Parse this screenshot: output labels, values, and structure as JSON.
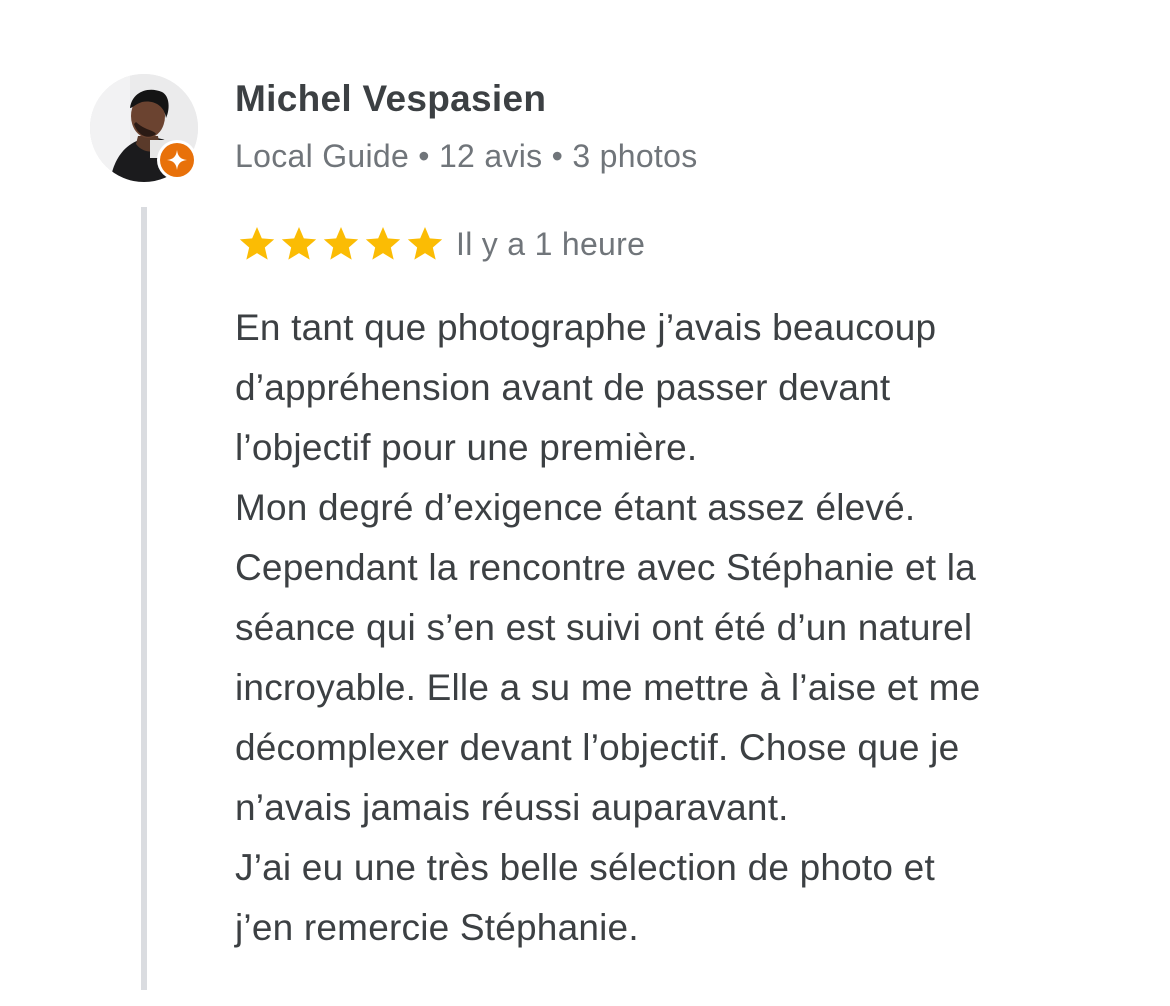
{
  "reviewer": {
    "name": "Michel Vespasien",
    "meta": "Local Guide • 12 avis • 3 photos",
    "avatar_icon": "person-photo-avatar",
    "badge_icon": "local-guide-star-icon",
    "badge_color": "#e8710a"
  },
  "review": {
    "rating": 5,
    "max_rating": 5,
    "star_color": "#fbbc04",
    "time": "Il y a 1 heure",
    "lines": [
      "En tant que photographe j’avais beaucoup",
      "d’appréhension avant de passer devant",
      "l’objectif pour une première.",
      "Mon degré d’exigence étant assez élevé.",
      "Cependant la rencontre avec Stéphanie et la",
      "séance qui s’en est suivi ont été d’un naturel",
      "incroyable. Elle a su me mettre à l’aise et me",
      "décomplexer devant l’objectif. Chose que je",
      "n’avais jamais réussi auparavant.",
      "J’ai eu une très belle sélection de photo et",
      "j’en remercie Stéphanie."
    ]
  }
}
